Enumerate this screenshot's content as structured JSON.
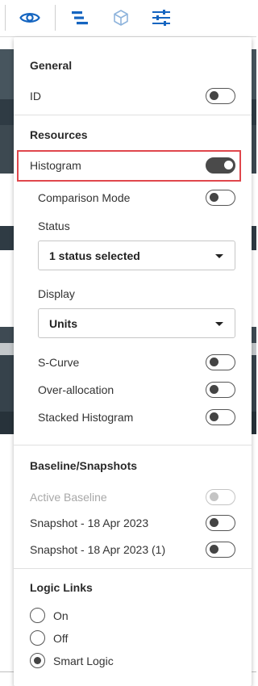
{
  "toolbar": {
    "icons": [
      "eye-icon",
      "gantt-icon",
      "cube-icon",
      "sliders-icon"
    ],
    "accent_color": "#1565c0"
  },
  "panel": {
    "general": {
      "title": "General",
      "id_label": "ID",
      "id_on": false
    },
    "resources": {
      "title": "Resources",
      "histogram_label": "Histogram",
      "histogram_on": true,
      "comparison_mode_label": "Comparison Mode",
      "comparison_mode_on": false,
      "status_label": "Status",
      "status_value": "1 status selected",
      "display_label": "Display",
      "display_value": "Units",
      "s_curve_label": "S-Curve",
      "s_curve_on": false,
      "over_allocation_label": "Over-allocation",
      "over_allocation_on": false,
      "stacked_histogram_label": "Stacked Histogram",
      "stacked_histogram_on": false
    },
    "baselines": {
      "title": "Baseline/Snapshots",
      "active_baseline_label": "Active Baseline",
      "active_baseline_disabled": true,
      "snapshot_1_label": "Snapshot - 18 Apr 2023",
      "snapshot_1_on": false,
      "snapshot_2_label": "Snapshot - 18 Apr 2023 (1)",
      "snapshot_2_on": false
    },
    "logic_links": {
      "title": "Logic Links",
      "options": [
        "On",
        "Off",
        "Smart Logic"
      ],
      "selected": "Smart Logic"
    }
  },
  "colors": {
    "highlight_border": "#e0474c",
    "toggle_dark": "#4a4a4a"
  }
}
